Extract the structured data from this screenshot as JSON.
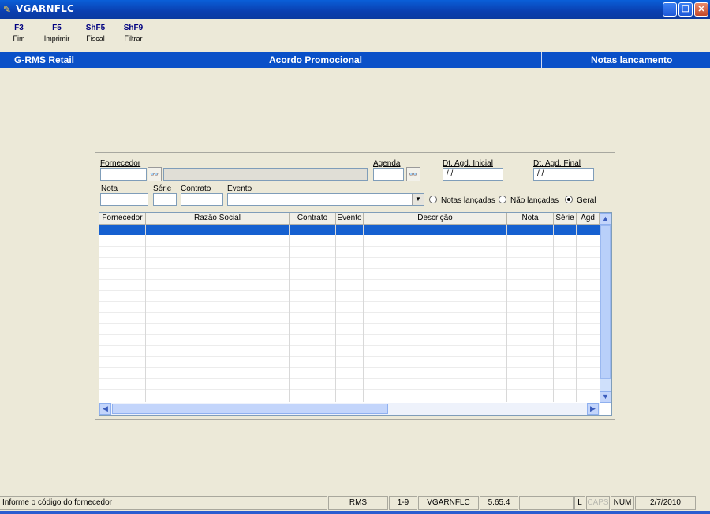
{
  "window": {
    "title": "VGARNFLC"
  },
  "fkeys": [
    {
      "key": "F3",
      "label": "Fim"
    },
    {
      "key": "F5",
      "label": "Imprimir"
    },
    {
      "key": "ShF5",
      "label": "Fiscal"
    },
    {
      "key": "ShF9",
      "label": "Filtrar"
    }
  ],
  "header": {
    "left": "G-RMS Retail",
    "center": "Acordo Promocional",
    "right": "Notas lancamento"
  },
  "form": {
    "fornecedor_label": "Fornecedor",
    "agenda_label": "Agenda",
    "dt_inicial_label": "Dt. Agd. Inicial",
    "dt_inicial_value": " / /",
    "dt_final_label": "Dt. Agd. Final",
    "dt_final_value": " / /",
    "nota_label": "Nota",
    "serie_label": "Série",
    "contrato_label": "Contrato",
    "evento_label": "Evento",
    "radio_notas": "Notas lançadas",
    "radio_nao": "Não lançadas",
    "radio_geral": "Geral",
    "radio_selected": "Geral"
  },
  "grid": {
    "columns": [
      "Fornecedor",
      "Razão Social",
      "Contrato",
      "Evento",
      "Descrição",
      "Nota",
      "Série",
      "Agd"
    ]
  },
  "status": {
    "message": "Informe o código do fornecedor",
    "system": "RMS",
    "range": "1-9",
    "program": "VGARNFLC",
    "version": "5.65.4",
    "flag_l": "L",
    "caps": "CAPS",
    "num": "NUM",
    "date": "2/7/2010"
  },
  "colors": {
    "titlebar": "#0a50c8",
    "selection": "#1560d0",
    "background": "#ece9d8"
  }
}
